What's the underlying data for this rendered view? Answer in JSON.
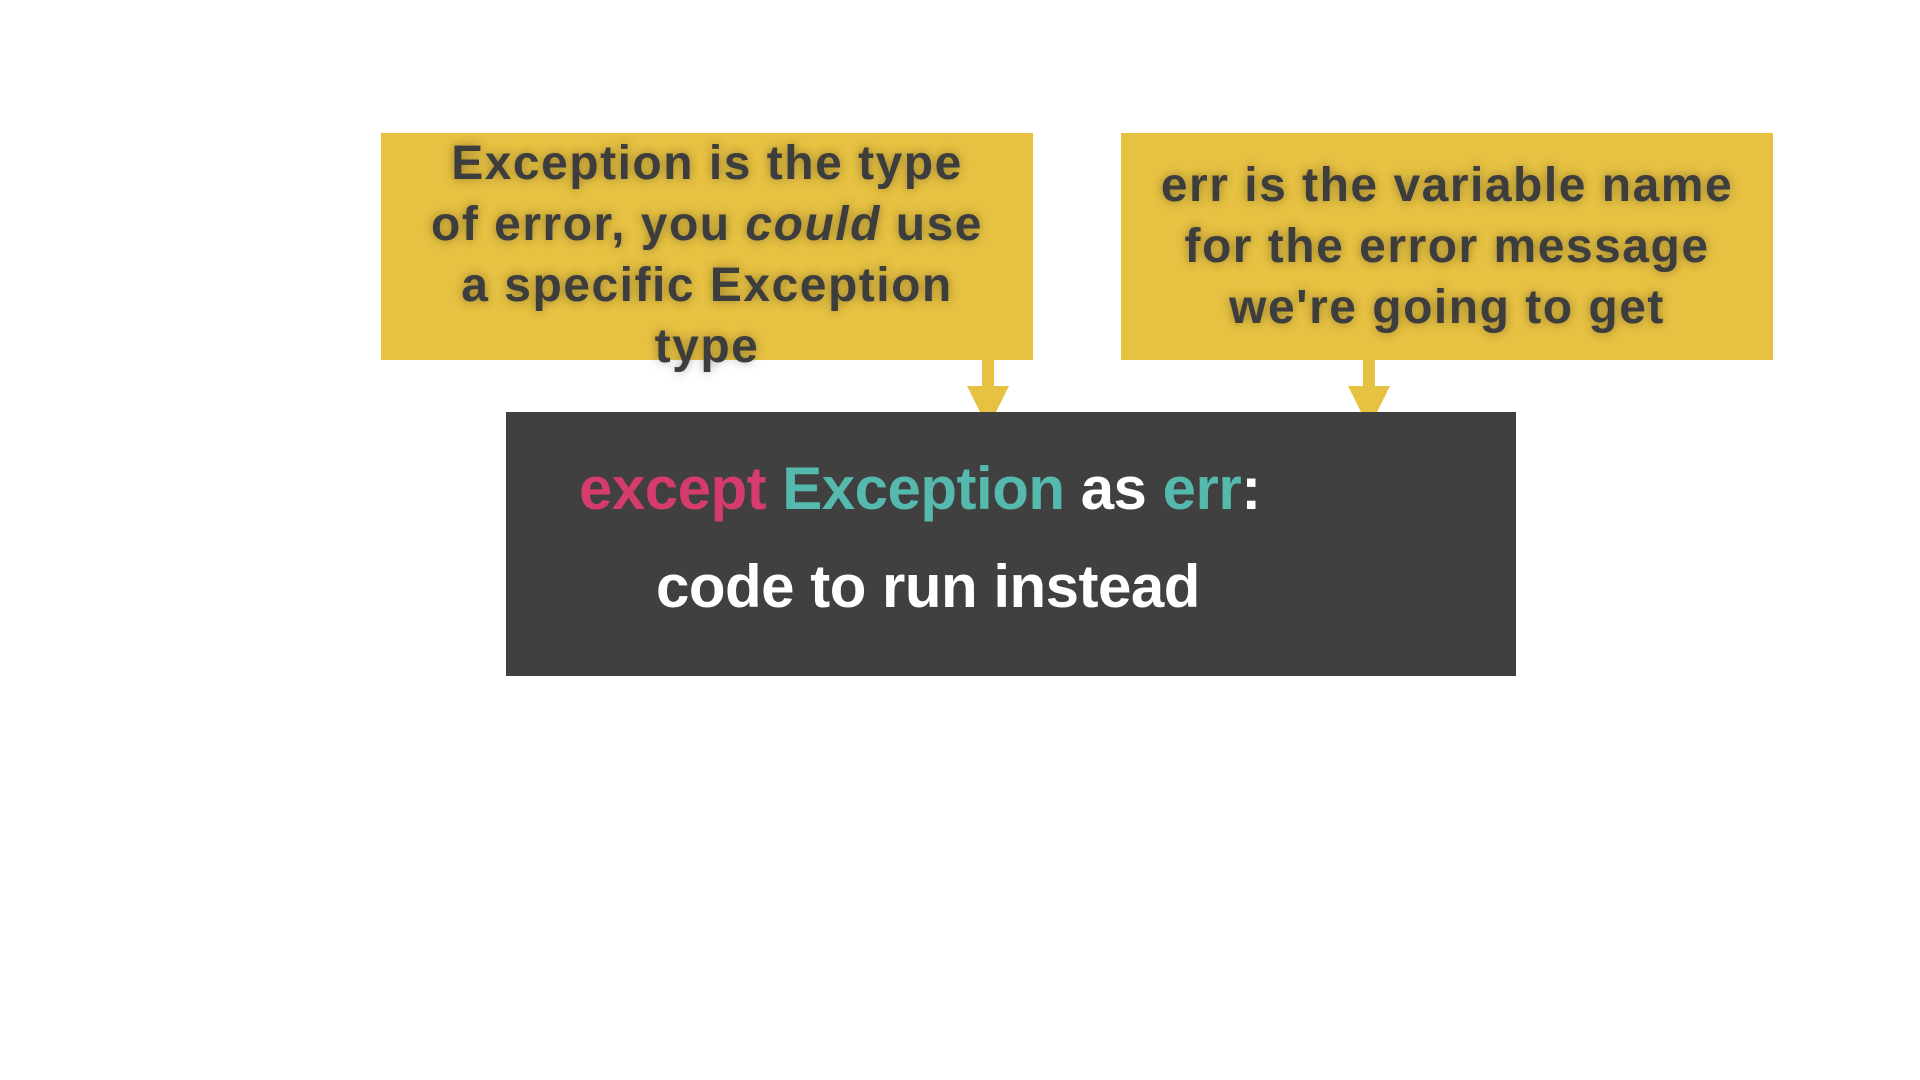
{
  "callouts": {
    "left": {
      "line1": "Exception is the type",
      "line2_pre": "of error, you ",
      "line2_em": "could",
      "line2_post": " use",
      "line3": "a specific Exception",
      "line4": "type"
    },
    "right": {
      "line1": "err is the variable name",
      "line2": "for the error message",
      "line3": "we're going to get"
    }
  },
  "code": {
    "keyword": "except",
    "exception_type": "Exception",
    "as_keyword": "as",
    "variable": "err",
    "colon": ":",
    "body": "code to run instead"
  },
  "colors": {
    "callout_bg": "#e6c142",
    "callout_text": "#3d3d3d",
    "code_bg": "#404040",
    "keyword": "#d63c6b",
    "type": "#56b9ad",
    "plain": "#ffffff"
  }
}
